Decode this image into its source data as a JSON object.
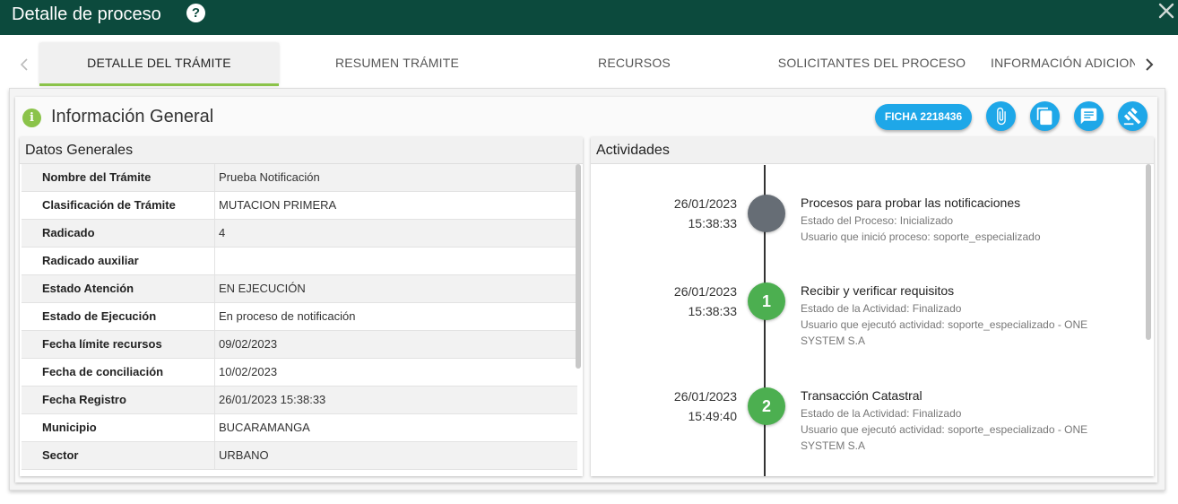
{
  "window": {
    "title": "Detalle de proceso",
    "help_glyph": "?"
  },
  "tabs": [
    {
      "label": "DETALLE DEL TRÁMITE",
      "active": true
    },
    {
      "label": "RESUMEN TRÁMITE",
      "active": false
    },
    {
      "label": "RECURSOS",
      "active": false
    },
    {
      "label": "SOLICITANTES DEL PROCESO",
      "active": false
    },
    {
      "label": "INFORMACIÓN ADICIONAL",
      "active": false
    }
  ],
  "card": {
    "title": "Información General",
    "info_glyph": "i",
    "ficha_label": "FICHA 2218436",
    "action_icons": [
      "paperclip-icon",
      "copy-icon",
      "comment-icon",
      "gavel-icon"
    ]
  },
  "datos": {
    "title": "Datos Generales",
    "rows": [
      {
        "label": "Nombre del Trámite",
        "value": "Prueba Notificación"
      },
      {
        "label": "Clasificación de Trámite",
        "value": "MUTACION PRIMERA"
      },
      {
        "label": "Radicado",
        "value": "4"
      },
      {
        "label": "Radicado auxiliar",
        "value": ""
      },
      {
        "label": "Estado Atención",
        "value": "EN EJECUCIÓN"
      },
      {
        "label": "Estado de Ejecución",
        "value": "En proceso de notificación"
      },
      {
        "label": "Fecha límite recursos",
        "value": "09/02/2023"
      },
      {
        "label": "Fecha de conciliación",
        "value": "10/02/2023"
      },
      {
        "label": "Fecha Registro",
        "value": "26/01/2023 15:38:33"
      },
      {
        "label": "Municipio",
        "value": "BUCARAMANGA"
      },
      {
        "label": "Sector",
        "value": "URBANO"
      }
    ]
  },
  "actividades": {
    "title": "Actividades",
    "items": [
      {
        "date": "26/01/2023",
        "time": "15:38:33",
        "marker": "",
        "title": "Procesos para probar las notificaciones",
        "line1": "Estado del Proceso: Inicializado",
        "line2": "Usuario que inició proceso: soporte_especializado"
      },
      {
        "date": "26/01/2023",
        "time": "15:38:33",
        "marker": "1",
        "title": "Recibir y verificar requisitos",
        "line1": "Estado de la Actividad: Finalizado",
        "line2": "Usuario que ejecutó actividad: soporte_especializado - ONE SYSTEM S.A"
      },
      {
        "date": "26/01/2023",
        "time": "15:49:40",
        "marker": "2",
        "title": "Transacción Catastral",
        "line1": "Estado de la Actividad: Finalizado",
        "line2": "Usuario que ejecutó actividad: soporte_especializado - ONE SYSTEM S.A"
      }
    ]
  },
  "colors": {
    "header": "#0c4a3d",
    "accent_blue": "#1ea7e8",
    "accent_green": "#8bc34a",
    "done_green": "#4caf50",
    "pending_gray": "#666d75"
  }
}
